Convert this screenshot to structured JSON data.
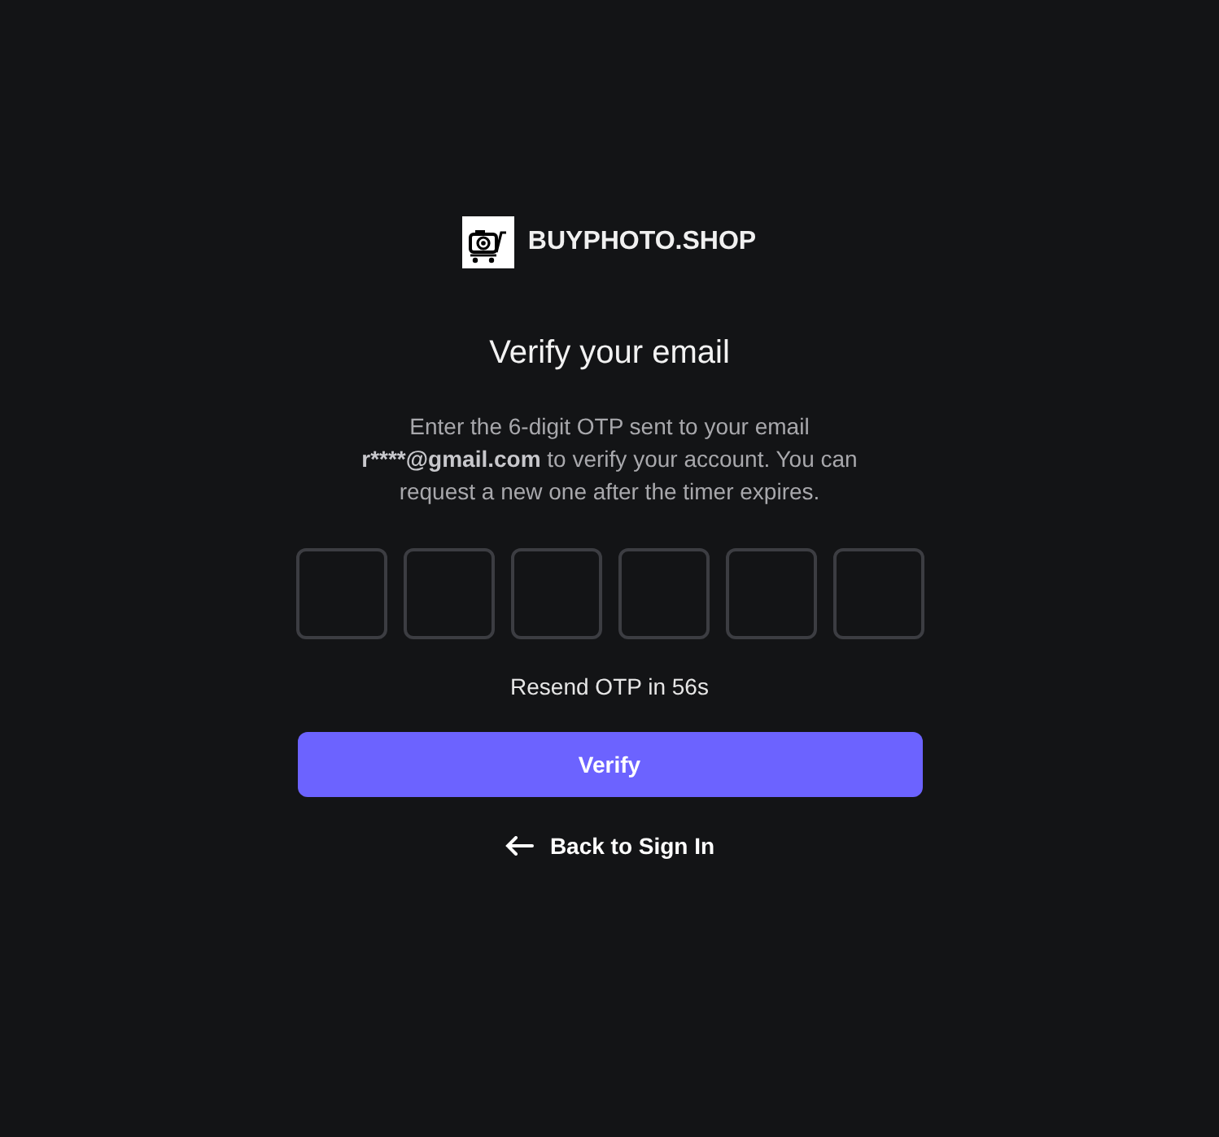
{
  "brand": {
    "name": "BUYPHOTO.SHOP"
  },
  "title": "Verify your email",
  "description": {
    "before": "Enter the 6-digit OTP sent to your email",
    "email": "r****@gmail.com",
    "after": "to verify your account. You can request a new one after the timer expires."
  },
  "otp_fields": [
    {
      "kind": "digit"
    },
    {
      "kind": "digit"
    },
    {
      "kind": "digit"
    },
    {
      "kind": "digit"
    },
    {
      "kind": "digit"
    },
    {
      "kind": "digit"
    }
  ],
  "resend_timer": "Resend OTP in 56s",
  "verify_button": "Verify",
  "back_link": "Back to Sign In"
}
